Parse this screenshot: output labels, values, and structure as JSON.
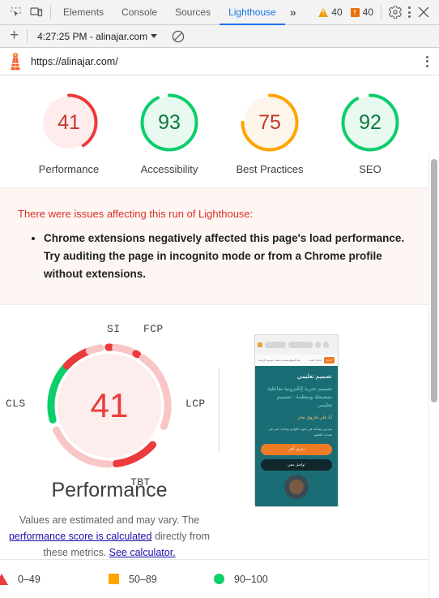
{
  "devtools": {
    "icons": {
      "inspect": "inspect-element-icon",
      "device": "device-toolbar-icon"
    },
    "tabs": [
      {
        "label": "Elements",
        "active": false
      },
      {
        "label": "Console",
        "active": false
      },
      {
        "label": "Sources",
        "active": false
      },
      {
        "label": "Lighthouse",
        "active": true
      }
    ],
    "more_tabs": "»",
    "warnings_count": "40",
    "issues_count": "40",
    "settings_label": "Settings",
    "menu_label": "Customize and control DevTools",
    "close_label": "Close DevTools"
  },
  "lh_toolbar": {
    "new_audit": "+",
    "run_selector": "4:27:25 PM - alinajar.com",
    "clear_label": "Clear all"
  },
  "url_bar": {
    "url": "https://alinajar.com/",
    "logo": "lighthouse-logo"
  },
  "scores": [
    {
      "label": "Performance",
      "value": "41",
      "score": 41,
      "color": "#eb3b3b",
      "track": "#ffeded",
      "text_color": "#c0392b"
    },
    {
      "label": "Accessibility",
      "value": "93",
      "score": 93,
      "color": "#0cce6b",
      "track": "#e8faf0",
      "text_color": "#0b7a41"
    },
    {
      "label": "Best Practices",
      "value": "75",
      "score": 75,
      "color": "#ffa400",
      "track": "#fdf6ea",
      "text_color": "#c0392b"
    },
    {
      "label": "SEO",
      "value": "92",
      "score": 92,
      "color": "#0cce6b",
      "track": "#e8faf0",
      "text_color": "#0b7a41"
    }
  ],
  "warning": {
    "title": "There were issues affecting this run of Lighthouse:",
    "items": [
      "Chrome extensions negatively affected this page's load performance. Try auditing the page in incognito mode or from a Chrome profile without extensions."
    ]
  },
  "performance": {
    "value": "41",
    "heading": "Performance",
    "metrics": [
      {
        "key": "FCP",
        "label": "FCP"
      },
      {
        "key": "LCP",
        "label": "LCP"
      },
      {
        "key": "TBT",
        "label": "TBT"
      },
      {
        "key": "CLS",
        "label": "CLS"
      },
      {
        "key": "SI",
        "label": "SI"
      }
    ],
    "note_prefix": "Values are estimated and may vary. The ",
    "note_link1": "performance score is calculated",
    "note_mid": " directly from these metrics. ",
    "note_link2": "See calculator."
  },
  "thumbnail": {
    "alt": "page-screenshot-thumbnail",
    "cookie_text": "هذا الموقع يستخدم ملفات تعريف الارتباط",
    "cookie_more": "Learn more",
    "cookie_accept": "Got it",
    "heading1": "تصميم تعليمي",
    "heading2": "تصميم تجربة إلكترونية تفاعلية منضبطة ومنظمة - تصميم تعليمي",
    "heading3": "أنا علي فاروق نجار",
    "paragraph": "مدرس مساعد في جنوب الوادي وباحث خبير في تقنيات التعليم",
    "btn_primary": "اعرف أكثر",
    "btn_secondary": "تواصل معي"
  },
  "legend": [
    {
      "shape": "triangle",
      "range": "0–49",
      "color": "#eb3b3b"
    },
    {
      "shape": "square",
      "range": "50–89",
      "color": "#ffa400"
    },
    {
      "shape": "circle",
      "range": "90–100",
      "color": "#0cce6b"
    }
  ]
}
